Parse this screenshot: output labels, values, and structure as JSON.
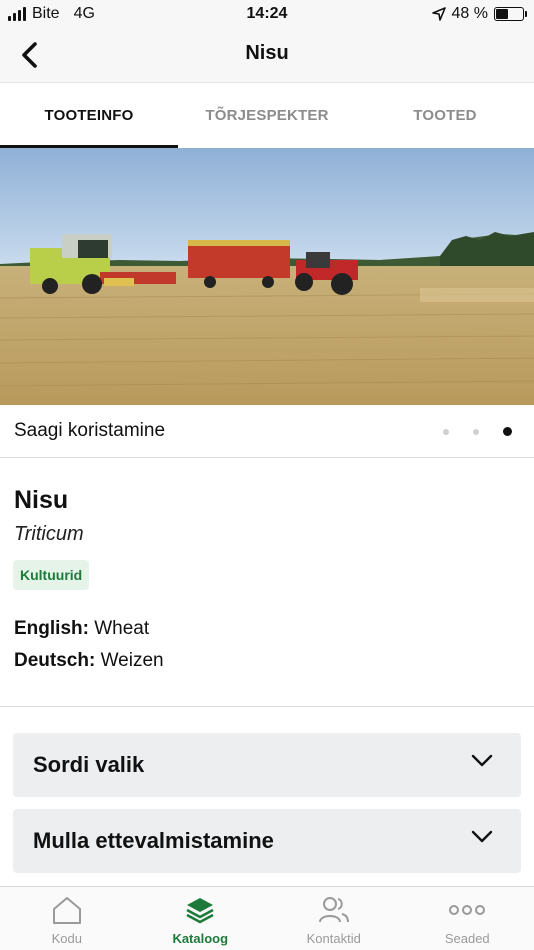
{
  "status_bar": {
    "carrier": "Bite",
    "network": "4G",
    "time": "14:24",
    "battery": "48 %",
    "battery_level": 0.48
  },
  "nav": {
    "title": "Nisu",
    "back_icon": "chevron-left-icon"
  },
  "tabs": [
    {
      "label": "TOOTEINFO",
      "active": true
    },
    {
      "label": "TÕRJESPEKTER",
      "active": false
    },
    {
      "label": "TOOTED",
      "active": false
    }
  ],
  "hero": {
    "caption": "Saagi koristamine",
    "slide_count": 3,
    "active_slide": 3
  },
  "plant": {
    "name": "Nisu",
    "latin": "Triticum",
    "tag": "Kultuurid",
    "languages": [
      {
        "key": "English:",
        "value": "Wheat"
      },
      {
        "key": "Deutsch:",
        "value": "Weizen"
      }
    ]
  },
  "accordions": [
    {
      "label": "Sordi valik"
    },
    {
      "label": "Mulla ettevalmistamine"
    }
  ],
  "tabbar": [
    {
      "label": "Kodu",
      "icon": "home-icon",
      "active": false
    },
    {
      "label": "Kataloog",
      "icon": "layers-icon",
      "active": true
    },
    {
      "label": "Kontaktid",
      "icon": "contacts-icon",
      "active": false
    },
    {
      "label": "Seaded",
      "icon": "more-icon",
      "active": false
    }
  ],
  "colors": {
    "accent": "#1e7a3a",
    "tag_bg": "#e6f3e9",
    "accordion_bg": "#eceef0"
  }
}
